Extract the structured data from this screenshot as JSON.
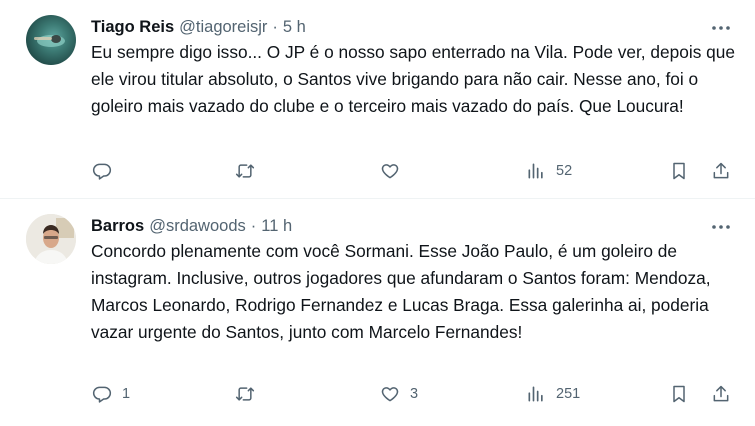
{
  "tweets": [
    {
      "name": "Tiago Reis",
      "handle": "@tiagoreisjr",
      "separator": "·",
      "time": "5 h",
      "text": "Eu sempre digo isso... O JP é o nosso sapo enterrado na Vila. Pode ver, depois que ele virou titular absoluto, o Santos vive brigando para não cair. Nesse ano, foi o goleiro mais vazado do clube e o terceiro mais vazado do país. Que Loucura!",
      "replies": "",
      "retweets": "",
      "likes": "",
      "views": "52"
    },
    {
      "name": "Barros",
      "handle": "@srdawoods",
      "separator": "·",
      "time": "11 h",
      "text": "Concordo plenamente com você Sormani. Esse João Paulo, é um goleiro de instagram. Inclusive, outros jogadores que afundaram o Santos foram: Mendoza, Marcos Leonardo, Rodrigo Fernandez e Lucas Braga. Essa galerinha ai, poderia vazar urgente do Santos, junto com Marcelo Fernandes!",
      "replies": "1",
      "retweets": "",
      "likes": "3",
      "views": "251"
    }
  ],
  "colors": {
    "text": "#0f1419",
    "secondary": "#536471",
    "divider": "#eff3f4"
  },
  "icons": [
    "more-icon",
    "reply-icon",
    "retweet-icon",
    "like-icon",
    "views-icon",
    "bookmark-icon",
    "share-icon"
  ]
}
